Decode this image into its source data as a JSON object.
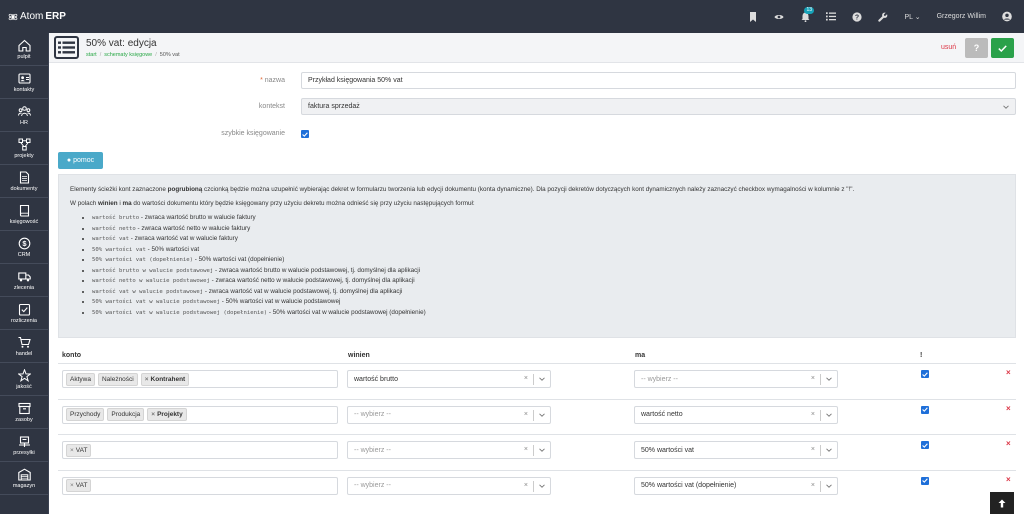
{
  "topbar": {
    "logo_text": "Atom",
    "logo_bold": "ERP",
    "notif_count": "13",
    "lang": "PL",
    "user": "Grzegorz Willim",
    "icons": [
      "bookmark-icon",
      "eye-icon",
      "bell-icon",
      "list-check-icon",
      "help-circle-icon",
      "wrench-icon"
    ]
  },
  "sidebar": {
    "items": [
      {
        "label": "pulpit",
        "icon": "home-icon"
      },
      {
        "label": "kontakty",
        "icon": "contact-card-icon"
      },
      {
        "label": "HR",
        "icon": "people-icon"
      },
      {
        "label": "projekty",
        "icon": "nodes-icon"
      },
      {
        "label": "dokumenty",
        "icon": "document-icon"
      },
      {
        "label": "księgowość",
        "icon": "book-icon"
      },
      {
        "label": "CRM",
        "icon": "dollar-icon"
      },
      {
        "label": "zlecenia",
        "icon": "truck-icon"
      },
      {
        "label": "rozliczenia",
        "icon": "checklist-icon"
      },
      {
        "label": "handel",
        "icon": "cart-icon"
      },
      {
        "label": "jakość",
        "icon": "star-icon"
      },
      {
        "label": "zasoby",
        "icon": "box-icon"
      },
      {
        "label": "przesyłki",
        "icon": "shipping-icon"
      },
      {
        "label": "magazyn",
        "icon": "warehouse-icon"
      }
    ]
  },
  "header": {
    "title": "50% vat: edycja",
    "breadcrumb": [
      "start",
      "schematy księgowe",
      "50% vat"
    ],
    "delete_label": "usuń",
    "help_label": "?"
  },
  "form": {
    "name_label": "nazwa",
    "name_required_mark": "*",
    "name_value": "Przykład księgowania 50% vat",
    "context_label": "kontekst",
    "context_value": "faktura sprzedaż",
    "quick_label": "szybkie księgowanie",
    "quick_checked": true
  },
  "help_button": "pomoc",
  "info": {
    "p1_a": "Elementy ścieżki kont zaznaczone ",
    "p1_b": "pogrubioną",
    "p1_c": " czcionką będzie można uzupełnić wybierając dekret w formularzu tworzenia lub edycji dokumentu (konta dynamiczne). Dla pozycji dekretów dotyczących kont dynamicznych należy zaznaczyć checkbox wymagalności w kolumnie z \"!\".",
    "p2_a": "W polach ",
    "p2_b": "winien",
    "p2_c": " i ",
    "p2_d": "ma",
    "p2_e": " do wartości dokumentu który będzie księgowany przy użyciu dekretu można odnieść się przy użyciu następujących formuł:",
    "formulas": [
      {
        "code": "wartość brutto",
        "desc": "- zwraca wartość brutto w walucie faktury"
      },
      {
        "code": "wartość netto",
        "desc": "- zwraca wartość netto w walucie faktury"
      },
      {
        "code": "wartość vat",
        "desc": "- zwraca wartość vat w walucie faktury"
      },
      {
        "code": "50% wartości vat",
        "desc": "- 50% wartości vat"
      },
      {
        "code": "50% wartości vat (dopełnienie)",
        "desc": "- 50% wartości vat (dopełnienie)"
      },
      {
        "code": "wartość brutto w walucie podstawowej",
        "desc": "- zwraca wartość brutto w walucie podstawowej, tj. domyślnej dla aplikacji"
      },
      {
        "code": "wartość netto w walucie podstawowej",
        "desc": "- zwraca wartość netto w walucie podstawowej, tj. domyślnej dla aplikacji"
      },
      {
        "code": "wartość vat w walucie podstawowej",
        "desc": "- zwraca wartość vat w walucie podstawowej, tj. domyślnej dla aplikacji"
      },
      {
        "code": "50% wartości vat w walucie podstawowej",
        "desc": "- 50% wartości vat w walucie podstawowej"
      },
      {
        "code": "50% wartości vat w walucie podstawowej (dopełnienie)",
        "desc": "- 50% wartości vat w walucie podstawowej (dopełnienie)"
      }
    ]
  },
  "table": {
    "headers": {
      "konto": "konto",
      "winien": "winien",
      "ma": "ma",
      "req": "!"
    },
    "placeholder": "-- wybierz --",
    "rows": [
      {
        "tags": [
          {
            "t": "Aktywa",
            "bold": false,
            "x": false
          },
          {
            "t": "Należności",
            "bold": false,
            "x": false
          },
          {
            "t": "Kontrahent",
            "bold": true,
            "x": true
          }
        ],
        "winien": "wartość brutto",
        "ma": "",
        "checked": true
      },
      {
        "tags": [
          {
            "t": "Przychody",
            "bold": false,
            "x": false
          },
          {
            "t": "Produkcja",
            "bold": false,
            "x": false
          },
          {
            "t": "Projekty",
            "bold": true,
            "x": true
          }
        ],
        "winien": "",
        "ma": "wartość netto",
        "checked": true
      },
      {
        "tags": [
          {
            "t": "VAT",
            "bold": false,
            "x": true
          }
        ],
        "winien": "",
        "ma": "50% wartości vat",
        "checked": true
      },
      {
        "tags": [
          {
            "t": "VAT",
            "bold": false,
            "x": true
          }
        ],
        "winien": "",
        "ma": "50% wartości vat (dopełnienie)",
        "checked": true
      }
    ]
  },
  "colors": {
    "dark": "#2f3542",
    "green": "#28a745",
    "blue": "#1e6fd9",
    "red": "#dc3545",
    "teal": "#4aa9c9"
  }
}
